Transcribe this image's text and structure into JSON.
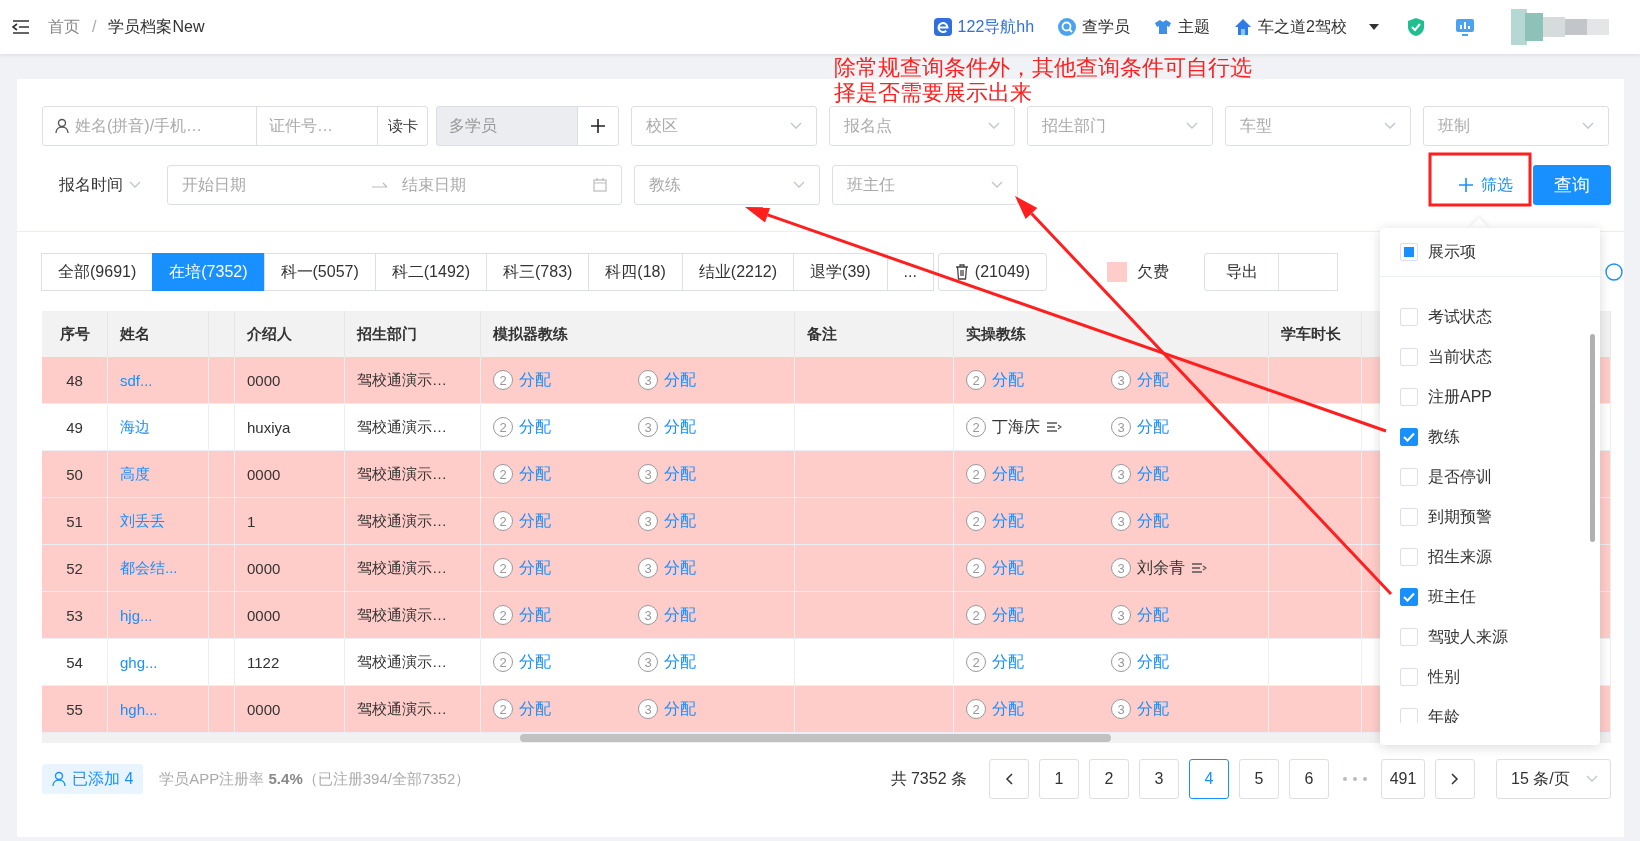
{
  "top_bar": {
    "breadcrumb": [
      {
        "label": "首页",
        "current": false
      },
      {
        "label": "学员档案New",
        "current": true
      }
    ],
    "breadcrumb_separator": "/",
    "shortcuts": [
      {
        "kind": "browser",
        "label": "122导航hh"
      },
      {
        "kind": "search",
        "label": "查学员"
      },
      {
        "kind": "shirt",
        "label": "主题"
      },
      {
        "kind": "school",
        "label": "车之道2驾校"
      }
    ]
  },
  "filters": {
    "name_field": {
      "placeholder": "姓名(拼音)/手机…"
    },
    "id_field": {
      "placeholder": "证件号…"
    },
    "read_card_button": "读卡",
    "multi_student_field": {
      "placeholder": "多学员",
      "disabled": true
    },
    "selects_row1": [
      {
        "placeholder": "校区"
      },
      {
        "placeholder": "报名点"
      },
      {
        "placeholder": "招生部门"
      },
      {
        "placeholder": "车型"
      },
      {
        "placeholder": "班制"
      }
    ],
    "date_type": "报名时间",
    "date_range": {
      "start_placeholder": "开始日期",
      "end_placeholder": "结束日期"
    },
    "selects_row2": [
      {
        "placeholder": "教练"
      },
      {
        "placeholder": "班主任"
      }
    ],
    "filter_button": "筛选",
    "query_button": "查询"
  },
  "annotation": {
    "text": "除常规查询条件外，其他查询条件可自行选择是否需要展示出来"
  },
  "status_tabs": [
    {
      "kind": "text",
      "label": "全部(9691)",
      "selected": false
    },
    {
      "kind": "text",
      "label": "在培(7352)",
      "selected": true
    },
    {
      "kind": "text",
      "label": "科一(5057)",
      "selected": false
    },
    {
      "kind": "text",
      "label": "科二(1492)",
      "selected": false
    },
    {
      "kind": "text",
      "label": "科三(783)",
      "selected": false
    },
    {
      "kind": "text",
      "label": "科四(18)",
      "selected": false
    },
    {
      "kind": "text",
      "label": "结业(2212)",
      "selected": false
    },
    {
      "kind": "text",
      "label": "退学(39)",
      "selected": false
    },
    {
      "kind": "text",
      "label": "...",
      "selected": false
    },
    {
      "kind": "trash",
      "label": "(21049)",
      "selected": false
    }
  ],
  "legend": {
    "color": "#ffcdc9",
    "label": "欠费"
  },
  "export_button": "导出",
  "table": {
    "columns": [
      {
        "label": "序号"
      },
      {
        "label": "姓名"
      },
      {
        "label": "介绍人"
      },
      {
        "label": "招生部门"
      },
      {
        "label": "模拟器教练"
      },
      {
        "label": "备注"
      },
      {
        "label": "实操教练"
      },
      {
        "label": "学车时长"
      }
    ],
    "rows": [
      {
        "no": "48",
        "name": "sdf...",
        "referrer": "0000",
        "department": "驾校通演示…",
        "owing": true,
        "simulator_coaches": [
          {
            "slot": "2",
            "name": "分配",
            "assigned": false
          },
          {
            "slot": "3",
            "name": "分配",
            "assigned": false
          }
        ],
        "field_coaches": [
          {
            "slot": "2",
            "name": "分配",
            "assigned": false
          },
          {
            "slot": "3",
            "name": "分配",
            "assigned": false
          }
        ]
      },
      {
        "no": "49",
        "name": "海边",
        "referrer": "huxiya",
        "department": "驾校通演示…",
        "owing": false,
        "simulator_coaches": [
          {
            "slot": "2",
            "name": "分配",
            "assigned": false
          },
          {
            "slot": "3",
            "name": "分配",
            "assigned": false
          }
        ],
        "field_coaches": [
          {
            "slot": "2",
            "name": "丁海庆",
            "assigned": true
          },
          {
            "slot": "3",
            "name": "分配",
            "assigned": false
          }
        ]
      },
      {
        "no": "50",
        "name": "高度",
        "referrer": "0000",
        "department": "驾校通演示…",
        "owing": true,
        "simulator_coaches": [
          {
            "slot": "2",
            "name": "分配",
            "assigned": false
          },
          {
            "slot": "3",
            "name": "分配",
            "assigned": false
          }
        ],
        "field_coaches": [
          {
            "slot": "2",
            "name": "分配",
            "assigned": false
          },
          {
            "slot": "3",
            "name": "分配",
            "assigned": false
          }
        ]
      },
      {
        "no": "51",
        "name": "刘丢丢",
        "referrer": "1",
        "department": "驾校通演示…",
        "owing": true,
        "simulator_coaches": [
          {
            "slot": "2",
            "name": "分配",
            "assigned": false
          },
          {
            "slot": "3",
            "name": "分配",
            "assigned": false
          }
        ],
        "field_coaches": [
          {
            "slot": "2",
            "name": "分配",
            "assigned": false
          },
          {
            "slot": "3",
            "name": "分配",
            "assigned": false
          }
        ]
      },
      {
        "no": "52",
        "name": "都会结...",
        "referrer": "0000",
        "department": "驾校通演示…",
        "owing": true,
        "simulator_coaches": [
          {
            "slot": "2",
            "name": "分配",
            "assigned": false
          },
          {
            "slot": "3",
            "name": "分配",
            "assigned": false
          }
        ],
        "field_coaches": [
          {
            "slot": "2",
            "name": "分配",
            "assigned": false
          },
          {
            "slot": "3",
            "name": "刘余青",
            "assigned": true
          }
        ]
      },
      {
        "no": "53",
        "name": "hjg...",
        "referrer": "0000",
        "department": "驾校通演示…",
        "owing": true,
        "simulator_coaches": [
          {
            "slot": "2",
            "name": "分配",
            "assigned": false
          },
          {
            "slot": "3",
            "name": "分配",
            "assigned": false
          }
        ],
        "field_coaches": [
          {
            "slot": "2",
            "name": "分配",
            "assigned": false
          },
          {
            "slot": "3",
            "name": "分配",
            "assigned": false
          }
        ]
      },
      {
        "no": "54",
        "name": "ghg...",
        "referrer": "1122",
        "department": "驾校通演示…",
        "owing": false,
        "simulator_coaches": [
          {
            "slot": "2",
            "name": "分配",
            "assigned": false
          },
          {
            "slot": "3",
            "name": "分配",
            "assigned": false
          }
        ],
        "field_coaches": [
          {
            "slot": "2",
            "name": "分配",
            "assigned": false
          },
          {
            "slot": "3",
            "name": "分配",
            "assigned": false
          }
        ]
      },
      {
        "no": "55",
        "name": "hgh...",
        "referrer": "0000",
        "department": "驾校通演示…",
        "owing": true,
        "simulator_coaches": [
          {
            "slot": "2",
            "name": "分配",
            "assigned": false
          },
          {
            "slot": "3",
            "name": "分配",
            "assigned": false
          }
        ],
        "field_coaches": [
          {
            "slot": "2",
            "name": "分配",
            "assigned": false
          },
          {
            "slot": "3",
            "name": "分配",
            "assigned": false
          }
        ]
      }
    ]
  },
  "column_picker": {
    "header": {
      "label": "展示项",
      "partial": true
    },
    "items": [
      {
        "label": "考试状态",
        "checked": false
      },
      {
        "label": "当前状态",
        "checked": false
      },
      {
        "label": "注册APP",
        "checked": false
      },
      {
        "label": "教练",
        "checked": true
      },
      {
        "label": "是否停训",
        "checked": false
      },
      {
        "label": "到期预警",
        "checked": false
      },
      {
        "label": "招生来源",
        "checked": false
      },
      {
        "label": "班主任",
        "checked": true
      },
      {
        "label": "驾驶人来源",
        "checked": false
      },
      {
        "label": "性别",
        "checked": false
      },
      {
        "label": "年龄",
        "checked": false
      }
    ]
  },
  "footer": {
    "added_button": "已添加 4",
    "registration_rate": "学员APP注册率 **5.4%**（已注册394/全部7352）",
    "total": "共 7352 条",
    "pages": [
      {
        "label": "1",
        "selected": false
      },
      {
        "label": "2",
        "selected": false
      },
      {
        "label": "3",
        "selected": false
      },
      {
        "label": "4",
        "selected": true
      },
      {
        "label": "5",
        "selected": false
      },
      {
        "label": "6",
        "selected": false
      }
    ],
    "last_page": {
      "label": "491",
      "selected": false
    },
    "page_size": "15 条/页"
  }
}
